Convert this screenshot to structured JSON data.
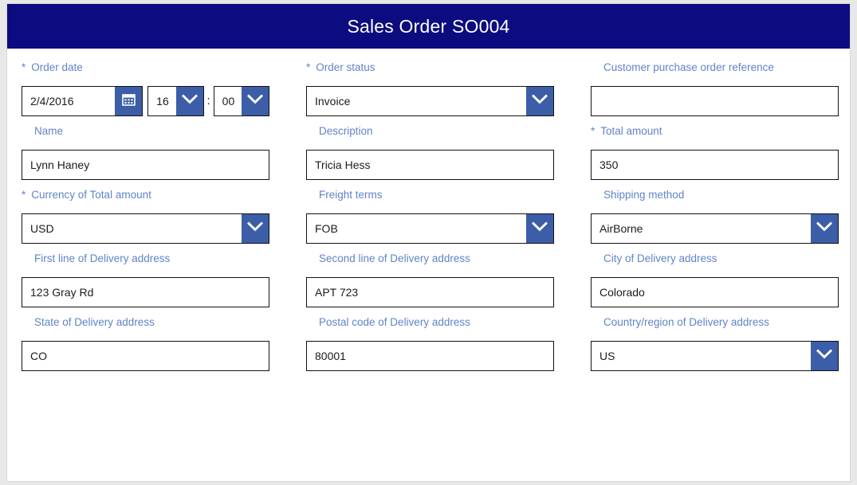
{
  "header": {
    "title": "Sales Order SO004"
  },
  "colors": {
    "header_bg": "#0c0c80",
    "label": "#6183c7",
    "dropdown_button": "#3c5ea8",
    "field_border": "#121212",
    "page_bg": "#e8e8e8"
  },
  "rows": [
    {
      "fields": [
        {
          "kind": "datetime",
          "name": "order-date",
          "label": "Order date",
          "required": true,
          "date_value": "2/4/2016",
          "hour_value": "16",
          "minute_value": "00",
          "separator": ":",
          "icon": "calendar-icon"
        },
        {
          "kind": "select",
          "name": "order-status",
          "label": "Order status",
          "required": true,
          "value": "Invoice"
        },
        {
          "kind": "text",
          "name": "customer-purchase-order-reference",
          "label": "Customer purchase order reference",
          "required": false,
          "value": ""
        }
      ]
    },
    {
      "fields": [
        {
          "kind": "text",
          "name": "name",
          "label": "Name",
          "required": false,
          "value": "Lynn Haney"
        },
        {
          "kind": "text",
          "name": "description",
          "label": "Description",
          "required": false,
          "value": "Tricia Hess"
        },
        {
          "kind": "text",
          "name": "total-amount",
          "label": "Total amount",
          "required": true,
          "value": "350"
        }
      ]
    },
    {
      "fields": [
        {
          "kind": "select",
          "name": "currency-of-total-amount",
          "label": "Currency of Total amount",
          "required": true,
          "value": "USD"
        },
        {
          "kind": "select",
          "name": "freight-terms",
          "label": "Freight terms",
          "required": false,
          "value": "FOB"
        },
        {
          "kind": "select",
          "name": "shipping-method",
          "label": "Shipping method",
          "required": false,
          "value": "AirBorne"
        }
      ]
    },
    {
      "fields": [
        {
          "kind": "text",
          "name": "first-line-of-delivery-address",
          "label": "First line of Delivery address",
          "required": false,
          "value": "123 Gray Rd"
        },
        {
          "kind": "text",
          "name": "second-line-of-delivery-address",
          "label": "Second line of Delivery address",
          "required": false,
          "value": "APT 723"
        },
        {
          "kind": "text",
          "name": "city-of-delivery-address",
          "label": "City of Delivery address",
          "required": false,
          "value": "Colorado"
        }
      ]
    },
    {
      "fields": [
        {
          "kind": "text",
          "name": "state-of-delivery-address",
          "label": "State of Delivery address",
          "required": false,
          "value": "CO"
        },
        {
          "kind": "text",
          "name": "postal-code-of-delivery-address",
          "label": "Postal code of Delivery address",
          "required": false,
          "value": "80001"
        },
        {
          "kind": "select",
          "name": "country-region-of-delivery-address",
          "label": "Country/region of Delivery address",
          "required": false,
          "value": "US"
        }
      ]
    }
  ]
}
